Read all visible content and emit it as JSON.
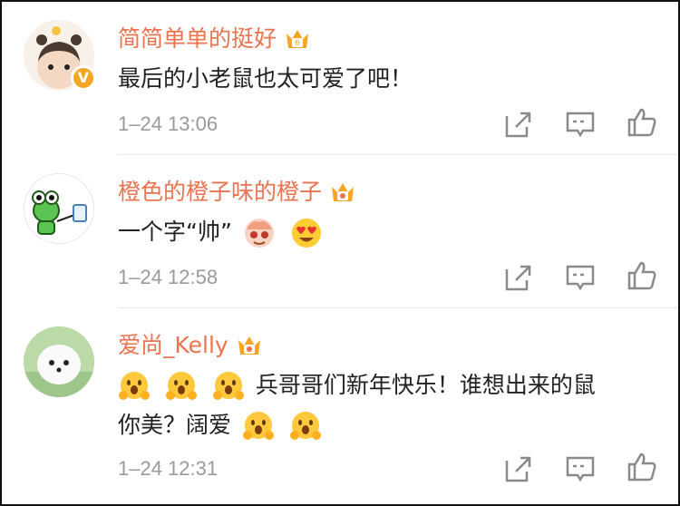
{
  "comments": [
    {
      "username": "简简单单的挺好",
      "avatar_icon": "baby-avatar",
      "verified": true,
      "verified_badge": "V",
      "text": "最后的小老鼠也太可爱了吧！",
      "time": "1–24 13:06"
    },
    {
      "username": "橙色的橙子味的橙子",
      "avatar_icon": "frog-avatar",
      "verified": false,
      "text_prefix": "一个字“帅”",
      "emojis": [
        "cute-character-emoji",
        "heart-eyes-emoji"
      ],
      "time": "1–24 12:58"
    },
    {
      "username": "爱尚_Kelly",
      "avatar_icon": "white-puppy-avatar",
      "verified": false,
      "line1_text": "兵哥哥们新年快乐！谁想出来的鼠",
      "line2_text": "你美？阔爱",
      "emojis_line1": [
        "hug-emoji",
        "hug-emoji",
        "hug-emoji"
      ],
      "emojis_line2": [
        "hug-emoji",
        "hug-emoji"
      ],
      "time": "1–24 12:31"
    }
  ],
  "actions": {
    "share_icon": "share-icon",
    "comment_icon": "comment-icon",
    "like_icon": "thumbs-up-icon"
  },
  "colors": {
    "username": "#eb7350",
    "time": "#9a9a9a",
    "icon": "#8a8a8a",
    "crown": "#f5a623"
  }
}
